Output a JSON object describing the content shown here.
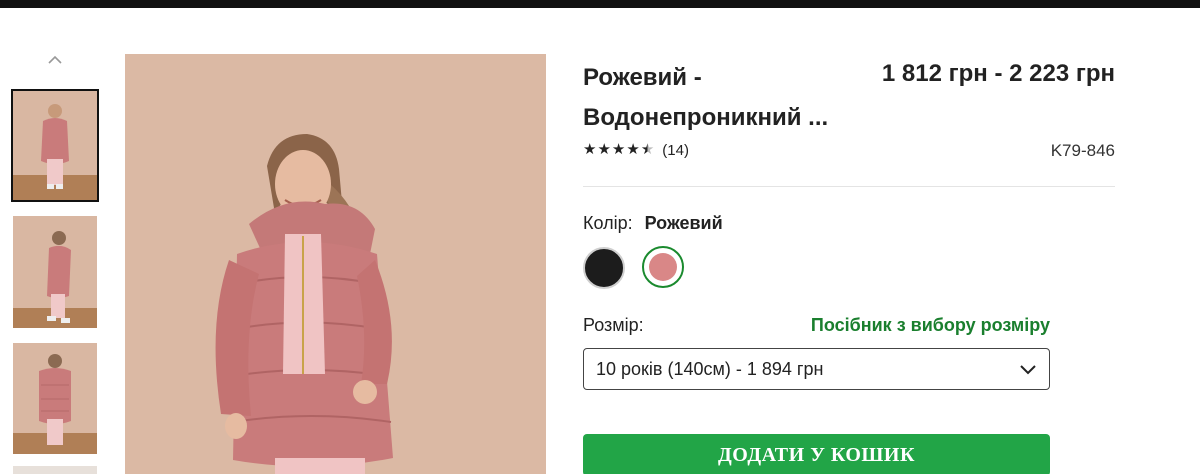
{
  "product": {
    "title_line1": "Рожевий -",
    "title_line2": "Водонепроникний ...",
    "price": "1 812 грн - 2 223 грн",
    "rating": {
      "value": 4.5,
      "stars": "★★★★★",
      "count": "(14)"
    },
    "sku": "K79-846"
  },
  "color": {
    "label": "Колір:",
    "selected": "Рожевий",
    "swatches": [
      {
        "name": "black",
        "hex": "#1c1c1c"
      },
      {
        "name": "pink",
        "hex": "#d98787",
        "selected": true
      }
    ]
  },
  "size": {
    "label": "Розмір:",
    "guide_link": "Посібник з вибору розміру",
    "selected_option": "10 років (140см) - 1 894 грн"
  },
  "cart": {
    "add_label": "ДОДАТИ У КОШИК"
  },
  "gallery": {
    "icons": {
      "up": "chevron-up-icon",
      "dropdown": "chevron-down-icon"
    },
    "thumbnails": [
      "front",
      "side",
      "back"
    ]
  },
  "colors": {
    "accent_green": "#22a547",
    "link_green": "#1a7f2e",
    "background_peach": "#dbb9a4",
    "jacket_pink": "#c97b7b"
  }
}
